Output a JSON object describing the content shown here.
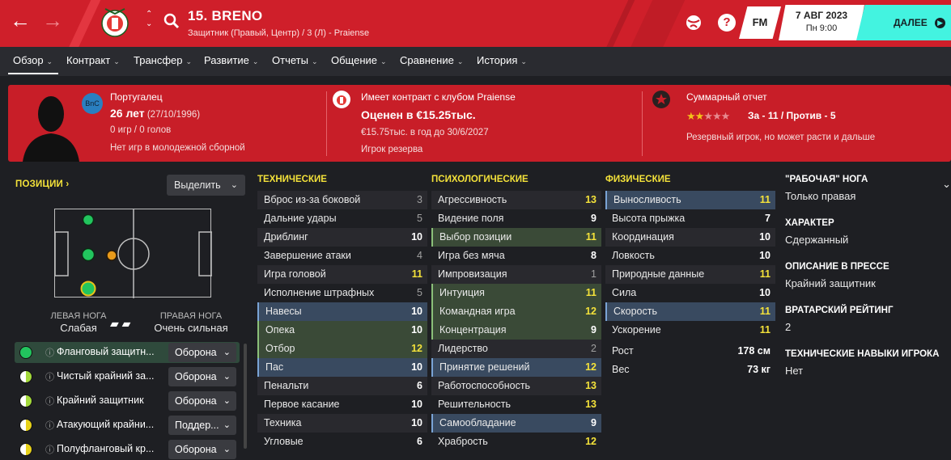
{
  "header": {
    "player_name": "15. BRENO",
    "player_sub": "Защитник (Правый, Центр) / 3 (Л) - Praiense",
    "date": "7 АВГ 2023",
    "time": "Пн 9:00",
    "next_label": "ДАЛЕЕ",
    "fm_label": "FM",
    "help_label": "?"
  },
  "tabs": [
    {
      "label": "Обзор"
    },
    {
      "label": "Контракт"
    },
    {
      "label": "Трансфер"
    },
    {
      "label": "Развитие"
    },
    {
      "label": "Отчеты"
    },
    {
      "label": "Общение"
    },
    {
      "label": "Сравнение"
    },
    {
      "label": "История"
    }
  ],
  "banner": {
    "nationality": "Португалец",
    "nation_badge": "BnC",
    "age": "26 лет",
    "dob": "(27/10/1996)",
    "games": "0 игр / 0 голов",
    "youth": "Нет игр в молодежной сборной",
    "contract_title": "Имеет контракт с клубом Praiense",
    "value": "Оценен в €15.25тыс.",
    "wage": "€15.75тыс. в год до 30/6/2027",
    "squad_status": "Игрок резерва",
    "report_title": "Суммарный отчет",
    "report_score": "За - 11 / Против - 5",
    "report_desc": "Резервный игрок, но может расти и дальше",
    "stars_filled": 2,
    "stars_total": 5
  },
  "positions": {
    "title": "ПОЗИЦИИ",
    "highlight_label": "Выделить",
    "left_foot_label": "ЛЕВАЯ НОГА",
    "left_foot_value": "Слабая",
    "right_foot_label": "ПРАВАЯ НОГА",
    "right_foot_value": "Очень сильная",
    "roles": [
      {
        "name": "Фланговый защитн...",
        "duty": "Оборона",
        "level": "full"
      },
      {
        "name": "Чистый крайний за...",
        "duty": "Оборона",
        "level": "half"
      },
      {
        "name": "Крайний защитник",
        "duty": "Оборона",
        "level": "half"
      },
      {
        "name": "Атакующий крайни...",
        "duty": "Поддер...",
        "level": "half-yellow"
      },
      {
        "name": "Полуфланговый кр...",
        "duty": "Оборона",
        "level": "half-yellow"
      }
    ]
  },
  "technical": {
    "title": "ТЕХНИЧЕСКИЕ",
    "rows": [
      {
        "name": "Вброс из-за боковой",
        "value": "3"
      },
      {
        "name": "Дальние удары",
        "value": "5"
      },
      {
        "name": "Дриблинг",
        "value": "10"
      },
      {
        "name": "Завершение атаки",
        "value": "4"
      },
      {
        "name": "Игра головой",
        "value": "11"
      },
      {
        "name": "Исполнение штрафных",
        "value": "5"
      },
      {
        "name": "Навесы",
        "value": "10"
      },
      {
        "name": "Опека",
        "value": "10"
      },
      {
        "name": "Отбор",
        "value": "12"
      },
      {
        "name": "Пас",
        "value": "10"
      },
      {
        "name": "Пенальти",
        "value": "6"
      },
      {
        "name": "Первое касание",
        "value": "10"
      },
      {
        "name": "Техника",
        "value": "10"
      },
      {
        "name": "Угловые",
        "value": "6"
      }
    ]
  },
  "mental": {
    "title": "ПСИХОЛОГИЧЕСКИЕ",
    "rows": [
      {
        "name": "Агрессивность",
        "value": "13"
      },
      {
        "name": "Видение поля",
        "value": "9"
      },
      {
        "name": "Выбор позиции",
        "value": "11"
      },
      {
        "name": "Игра без мяча",
        "value": "8"
      },
      {
        "name": "Импровизация",
        "value": "1"
      },
      {
        "name": "Интуиция",
        "value": "11"
      },
      {
        "name": "Командная игра",
        "value": "12"
      },
      {
        "name": "Концентрация",
        "value": "9"
      },
      {
        "name": "Лидерство",
        "value": "2"
      },
      {
        "name": "Принятие решений",
        "value": "12"
      },
      {
        "name": "Работоспособность",
        "value": "13"
      },
      {
        "name": "Решительность",
        "value": "13"
      },
      {
        "name": "Самообладание",
        "value": "9"
      },
      {
        "name": "Храбрость",
        "value": "12"
      }
    ]
  },
  "physical": {
    "title": "ФИЗИЧЕСКИЕ",
    "rows": [
      {
        "name": "Выносливость",
        "value": "11"
      },
      {
        "name": "Высота прыжка",
        "value": "7"
      },
      {
        "name": "Координация",
        "value": "10"
      },
      {
        "name": "Ловкость",
        "value": "10"
      },
      {
        "name": "Природные данные",
        "value": "11"
      },
      {
        "name": "Сила",
        "value": "10"
      },
      {
        "name": "Скорость",
        "value": "11"
      },
      {
        "name": "Ускорение",
        "value": "11"
      }
    ],
    "height_label": "Рост",
    "height": "178 см",
    "weight_label": "Вес",
    "weight": "73 кг"
  },
  "info": {
    "foot_title": "\"РАБОЧАЯ\" НОГА",
    "foot_value": "Только правая",
    "character_title": "ХАРАКТЕР",
    "character_value": "Сдержанный",
    "press_title": "ОПИСАНИЕ В ПРЕССЕ",
    "press_value": "Крайний защитник",
    "gk_title": "ВРАТАРСКИЙ РЕЙТИНГ",
    "gk_value": "2",
    "tech_title": "ТЕХНИЧЕСКИЕ НАВЫКИ ИГРОКА",
    "tech_value": "Нет"
  },
  "colors": {
    "header_red": "#cf1f2a",
    "banner_red": "#c81e28",
    "accent_cyan": "#43f3e0",
    "attr_yellow": "#f4e23a",
    "pos_green": "#22c55e",
    "pos_orange": "#e89a1a"
  }
}
